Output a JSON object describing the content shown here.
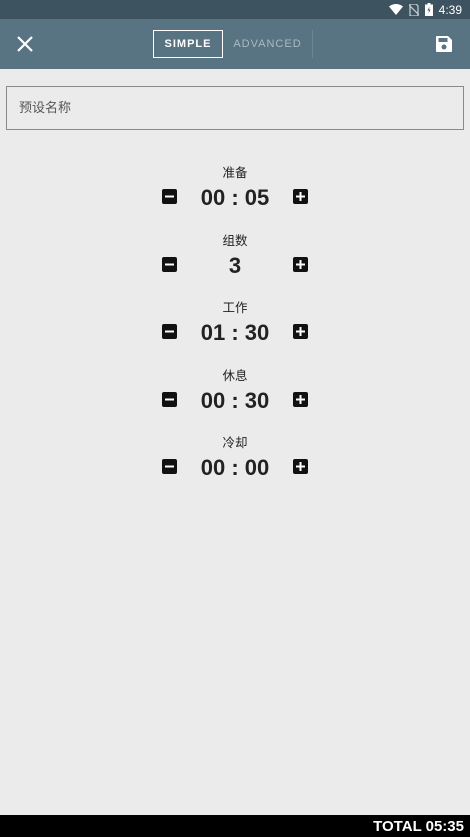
{
  "status_bar": {
    "time": "4:39",
    "icons": [
      "wifi-icon",
      "no-sim-icon",
      "battery-icon"
    ]
  },
  "toolbar": {
    "close_icon": "close-icon",
    "tabs": [
      {
        "label": "SIMPLE",
        "active": true
      },
      {
        "label": "ADVANCED",
        "active": false
      }
    ],
    "save_icon": "save-icon"
  },
  "preset_name": {
    "placeholder": "预设名称",
    "value": ""
  },
  "settings": [
    {
      "label": "准备",
      "value": "00 : 05"
    },
    {
      "label": "组数",
      "value": "3"
    },
    {
      "label": "工作",
      "value": "01 : 30"
    },
    {
      "label": "休息",
      "value": "00 : 30"
    },
    {
      "label": "冷却",
      "value": "00 : 00"
    }
  ],
  "footer": {
    "total": "TOTAL 05:35"
  },
  "colors": {
    "status_bar": "#3e5360",
    "toolbar": "#587381",
    "background": "#ebebeb",
    "footer": "#000000"
  }
}
